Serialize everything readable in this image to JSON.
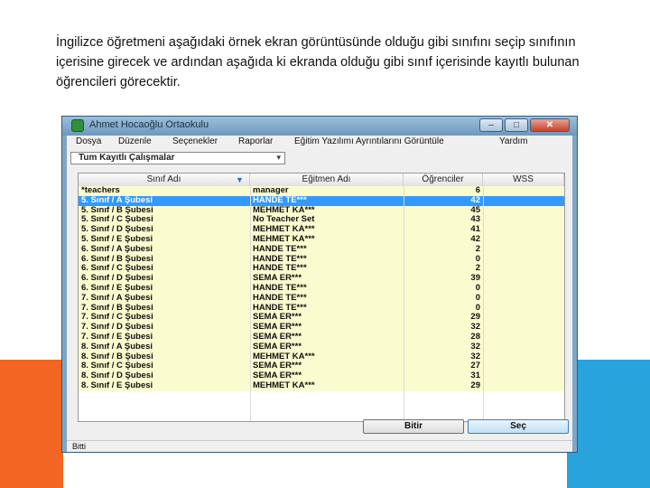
{
  "intro_text": "İngilizce öğretmeni aşağıdaki örnek ekran görüntüsünde olduğu gibi sınıfını seçip sınıfının içerisine girecek ve ardından aşağıda ki ekranda olduğu gibi sınıf içerisinde kayıtlı bulunan öğrencileri görecektir.",
  "colors": {
    "accent_orange": "#f26522",
    "accent_blue": "#29a3dc",
    "selected_row": "#3399ff",
    "row_background": "#fbfbd0"
  },
  "window": {
    "title": "Ahmet Hocaoğlu Ortaokulu",
    "icons": {
      "app": "app-logo-icon",
      "minimize": "minimize-icon",
      "maximize": "maximize-icon",
      "close": "close-icon"
    },
    "minimize_glyph": "–",
    "maximize_glyph": "□",
    "close_glyph": "✕"
  },
  "menu": [
    "Dosya",
    "Düzenle",
    "Seçenekler",
    "Raporlar",
    "Eğitim Yazılımı Ayrıntılarını Görüntüle",
    "Yardım"
  ],
  "filter": {
    "selected": "Tum Kayıtlı Çalışmalar",
    "arrow_glyph": "▾"
  },
  "table": {
    "columns": [
      "Sınıf Adı",
      "Eğitmen Adı",
      "Öğrenciler",
      "WSS"
    ],
    "sort_glyph": "▼",
    "rows": [
      {
        "cls": "*teachers",
        "teacher": "manager",
        "students": "6",
        "wss": ""
      },
      {
        "cls": "5. Sınıf / A Şubesi",
        "teacher": "HANDE TE***",
        "students": "42",
        "wss": "",
        "selected": true
      },
      {
        "cls": "5. Sınıf / B Şubesi",
        "teacher": "MEHMET KA***",
        "students": "45",
        "wss": ""
      },
      {
        "cls": "5. Sınıf / C Şubesi",
        "teacher": "No Teacher Set",
        "students": "43",
        "wss": ""
      },
      {
        "cls": "5. Sınıf / D Şubesi",
        "teacher": "MEHMET KA***",
        "students": "41",
        "wss": ""
      },
      {
        "cls": "5. Sınıf / E Şubesi",
        "teacher": "MEHMET KA***",
        "students": "42",
        "wss": ""
      },
      {
        "cls": "6. Sınıf / A Şubesi",
        "teacher": "HANDE TE***",
        "students": "2",
        "wss": ""
      },
      {
        "cls": "6. Sınıf / B Şubesi",
        "teacher": "HANDE TE***",
        "students": "0",
        "wss": ""
      },
      {
        "cls": "6. Sınıf / C Şubesi",
        "teacher": "HANDE TE***",
        "students": "2",
        "wss": ""
      },
      {
        "cls": "6. Sınıf / D Şubesi",
        "teacher": "SEMA ER***",
        "students": "39",
        "wss": ""
      },
      {
        "cls": "6. Sınıf / E Şubesi",
        "teacher": "HANDE TE***",
        "students": "0",
        "wss": ""
      },
      {
        "cls": "7. Sınıf / A Şubesi",
        "teacher": "HANDE TE***",
        "students": "0",
        "wss": ""
      },
      {
        "cls": "7. Sınıf / B Şubesi",
        "teacher": "HANDE TE***",
        "students": "0",
        "wss": ""
      },
      {
        "cls": "7. Sınıf / C Şubesi",
        "teacher": "SEMA ER***",
        "students": "29",
        "wss": ""
      },
      {
        "cls": "7. Sınıf / D Şubesi",
        "teacher": "SEMA ER***",
        "students": "32",
        "wss": ""
      },
      {
        "cls": "7. Sınıf / E Şubesi",
        "teacher": "SEMA ER***",
        "students": "28",
        "wss": ""
      },
      {
        "cls": "8. Sınıf / A Şubesi",
        "teacher": "SEMA ER***",
        "students": "32",
        "wss": ""
      },
      {
        "cls": "8. Sınıf / B Şubesi",
        "teacher": "MEHMET KA***",
        "students": "32",
        "wss": ""
      },
      {
        "cls": "8. Sınıf / C Şubesi",
        "teacher": "SEMA ER***",
        "students": "27",
        "wss": ""
      },
      {
        "cls": "8. Sınıf / D Şubesi",
        "teacher": "SEMA ER***",
        "students": "31",
        "wss": ""
      },
      {
        "cls": "8. Sınıf / E Şubesi",
        "teacher": "MEHMET KA***",
        "students": "29",
        "wss": ""
      }
    ]
  },
  "buttons": {
    "finish": "Bitir",
    "select": "Seç"
  },
  "status": "Bitti"
}
